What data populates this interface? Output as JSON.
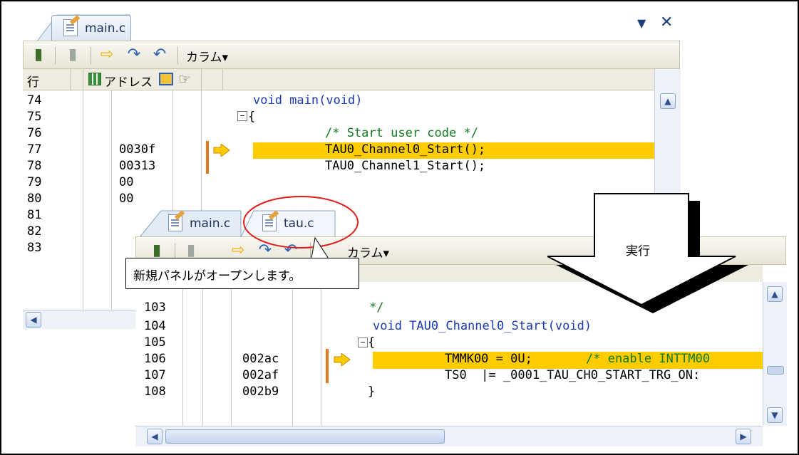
{
  "colors": {
    "highlight": "#ffcc00",
    "keyword": "#1a3bb5",
    "comment": "#127a1f",
    "current_marker": "#e07a1a"
  },
  "panel_main": {
    "tab_label": "main.c",
    "toolbar": {
      "icons": [
        "build-icon",
        "build-disabled-icon",
        "go-icon",
        "step-over-icon",
        "return-icon"
      ],
      "column_label": "カラム▾"
    },
    "headers": {
      "line": "行",
      "address": "アドレス"
    },
    "lines": [
      {
        "num": "74",
        "addr": "",
        "code": "void main(void)"
      },
      {
        "num": "75",
        "addr": "",
        "code": "{"
      },
      {
        "num": "76",
        "addr": "",
        "code": "/* Start user code */"
      },
      {
        "num": "77",
        "addr": "0030f",
        "code": "TAU0_Channel0_Start();"
      },
      {
        "num": "78",
        "addr": "00313",
        "code": "TAU0_Channel1_Start();"
      },
      {
        "num": "79",
        "addr": "00",
        "code": ""
      },
      {
        "num": "80",
        "addr": "00",
        "code": ""
      },
      {
        "num": "81",
        "addr": "",
        "code": ""
      },
      {
        "num": "82",
        "addr": "",
        "code": ""
      },
      {
        "num": "83",
        "addr": "",
        "code": ""
      }
    ]
  },
  "panel_tau": {
    "tabs": [
      "main.c",
      "tau.c"
    ],
    "toolbar": {
      "column_label": "カラム▾"
    },
    "lines": [
      {
        "num": "103",
        "addr": "",
        "code": "*/"
      },
      {
        "num": "104",
        "addr": "",
        "code": "void TAU0_Channel0_Start(void)"
      },
      {
        "num": "105",
        "addr": "",
        "code": "{"
      },
      {
        "num": "106",
        "addr": "002ac",
        "code": "TMMK00 = 0U;",
        "comment": "/* enable INTTM00"
      },
      {
        "num": "107",
        "addr": "002af",
        "code": "TS0  |= _0001_TAU_CH0_START_TRG_ON:"
      },
      {
        "num": "108",
        "addr": "002b9",
        "code": "}"
      }
    ]
  },
  "callout_text": "新規パネルがオープンします。",
  "arrow_label": "実行"
}
